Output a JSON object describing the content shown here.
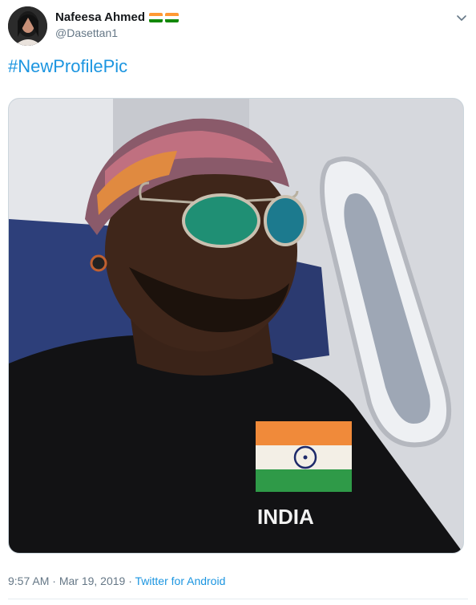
{
  "user": {
    "display_name": "Nafeesa Ahmed",
    "handle": "@Dasettan1",
    "flag_emoji_count": 2
  },
  "tweet": {
    "hashtag": "#NewProfilePic",
    "image_shirt_text": "INDIA",
    "time": "9:57 AM",
    "separator1": " · ",
    "date": "Mar 19, 2019",
    "separator2": " · ",
    "source": "Twitter for Android"
  },
  "icons": {
    "caret": "chevron-down-icon",
    "flags": "india-flag-emoji"
  },
  "colors": {
    "link": "#1b95e0",
    "secondary_text": "#657786",
    "saffron": "#ff9933",
    "india_green": "#138808",
    "chakra": "#000080"
  }
}
